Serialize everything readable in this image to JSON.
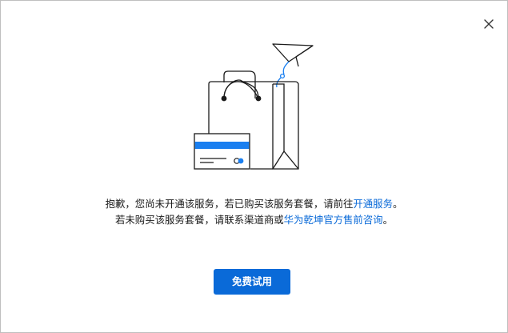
{
  "dialog": {
    "close_icon": "close-icon"
  },
  "illustration": {
    "icon": "shopping-bag-with-card-and-paper-plane",
    "accent_color": "#1a7ff0",
    "stroke_color": "#1a1a1a"
  },
  "message": {
    "line1_prefix": "抱歉，您尚未开通该服务，若已购买该服务套餐，请前往",
    "line1_link": "开通服务",
    "line1_suffix": "。",
    "line2_prefix": "若未购买该服务套餐，请联系渠道商或",
    "line2_link": "华为乾坤官方售前咨询",
    "line2_suffix": "。"
  },
  "actions": {
    "trial_label": "免费试用"
  },
  "colors": {
    "link": "#0a6ad8",
    "primary_button": "#0a6ad8",
    "text": "#191919",
    "border": "#bfbfbf"
  }
}
